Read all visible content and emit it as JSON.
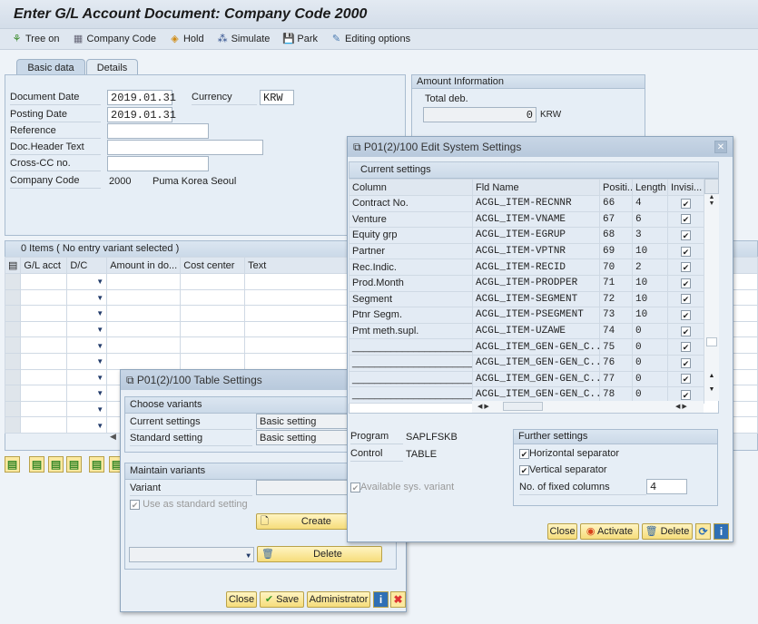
{
  "window": {
    "title": "Enter G/L Account Document: Company Code 2000"
  },
  "toolbar": [
    {
      "label": "Tree on",
      "icon": "tree-icon"
    },
    {
      "label": "Company Code",
      "icon": "company-code-icon"
    },
    {
      "label": "Hold",
      "icon": "hold-icon"
    },
    {
      "label": "Simulate",
      "icon": "simulate-icon"
    },
    {
      "label": "Park",
      "icon": "save-icon"
    },
    {
      "label": "Editing options",
      "icon": "pencil-icon"
    }
  ],
  "tabs": {
    "basic": "Basic data",
    "details": "Details"
  },
  "basic": {
    "doc_date_label": "Document Date",
    "doc_date": "2019.01.31",
    "currency_label": "Currency",
    "currency": "KRW",
    "post_date_label": "Posting Date",
    "post_date": "2019.01.31",
    "reference_label": "Reference",
    "reference": "",
    "header_text_label": "Doc.Header Text",
    "header_text": "",
    "cross_cc_label": "Cross-CC no.",
    "cross_cc": "",
    "company_code_label": "Company Code",
    "company_code": "2000",
    "company_name": "Puma Korea Seoul"
  },
  "amount": {
    "title": "Amount Information",
    "total_label": "Total deb.",
    "total": "0",
    "currency": "KRW"
  },
  "items": {
    "header": "0 Items ( No entry variant selected )",
    "columns": [
      "G/L acct",
      "D/C",
      "Amount in do...",
      "Cost center",
      "Text"
    ],
    "row_count": 10
  },
  "table_settings": {
    "title": "P01(2)/100 Table Settings",
    "choose_title": "Choose variants",
    "current_label": "Current settings",
    "current_value": "Basic setting",
    "standard_label": "Standard setting",
    "standard_value": "Basic setting",
    "maintain_title": "Maintain variants",
    "variant_label": "Variant",
    "variant_value": "",
    "use_std_label": "Use as standard setting",
    "use_std_checked": true,
    "create": "Create",
    "delete": "Delete",
    "close": "Close",
    "save": "Save",
    "administrator": "Administrator"
  },
  "sys_settings": {
    "title": "P01(2)/100 Edit System Settings",
    "current_title": "Current settings",
    "columns": [
      "Column",
      "Fld Name",
      "Positi...",
      "Length",
      "Invisi..."
    ],
    "rows": [
      [
        "Contract No.",
        "ACGL_ITEM-RECNNR",
        "66",
        "4",
        true
      ],
      [
        "Venture",
        "ACGL_ITEM-VNAME",
        "67",
        "6",
        true
      ],
      [
        "Equity grp",
        "ACGL_ITEM-EGRUP",
        "68",
        "3",
        true
      ],
      [
        "Partner",
        "ACGL_ITEM-VPTNR",
        "69",
        "10",
        true
      ],
      [
        "Rec.Indic.",
        "ACGL_ITEM-RECID",
        "70",
        "2",
        true
      ],
      [
        "Prod.Month",
        "ACGL_ITEM-PRODPER",
        "71",
        "10",
        true
      ],
      [
        "Segment",
        "ACGL_ITEM-SEGMENT",
        "72",
        "10",
        true
      ],
      [
        "Ptnr Segm.",
        "ACGL_ITEM-PSEGMENT",
        "73",
        "10",
        true
      ],
      [
        "Pmt meth.supl.",
        "ACGL_ITEM-UZAWE",
        "74",
        "0",
        true
      ],
      [
        "________________________..",
        "ACGL_ITEM_GEN-GEN_C..",
        "75",
        "0",
        true
      ],
      [
        "________________________..",
        "ACGL_ITEM_GEN-GEN_C..",
        "76",
        "0",
        true
      ],
      [
        "______________________",
        "ACGL_ITEM_GEN-GEN_C..",
        "77",
        "0",
        true
      ],
      [
        "______________________",
        "ACGL_ITEM_GEN-GEN_C..",
        "78",
        "0",
        true
      ]
    ],
    "program_label": "Program",
    "program": "SAPLFSKB",
    "control_label": "Control",
    "control": "TABLE",
    "avail_label": "Available sys. variant",
    "further_title": "Further settings",
    "hsep_label": "Horizontal separator",
    "vsep_label": "Vertical separator",
    "fixed_label": "No. of fixed columns",
    "fixed_value": "4",
    "close": "Close",
    "activate": "Activate",
    "delete": "Delete"
  }
}
